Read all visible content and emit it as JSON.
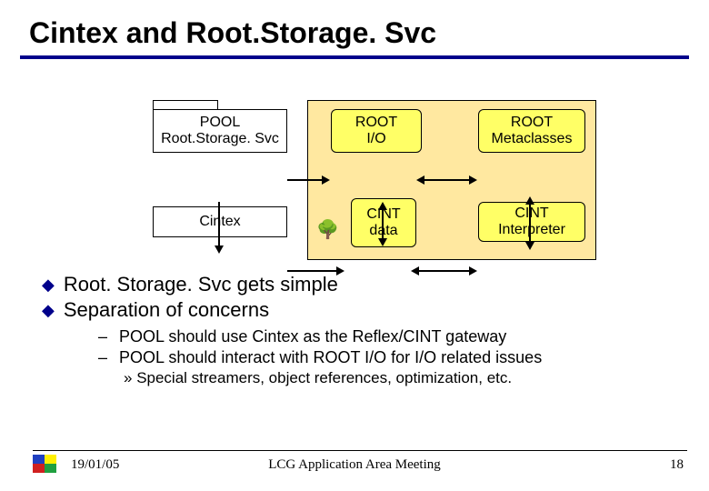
{
  "title": "Cintex and Root.Storage. Svc",
  "diagram": {
    "pool_line1": "POOL",
    "pool_line2": "Root.Storage. Svc",
    "cintex": "Cintex",
    "rootio_line1": "ROOT",
    "rootio_line2": "I/O",
    "rootmeta_line1": "ROOT",
    "rootmeta_line2": "Metaclasses",
    "cint_line1": "CINT",
    "cint_line2": "data",
    "cintinterp_line1": "CINT",
    "cintinterp_line2": "Interpreter"
  },
  "bullets": {
    "b1": "Root. Storage. Svc gets simple",
    "b2": "Separation of concerns",
    "s1": "POOL should use Cintex as the Reflex/CINT gateway",
    "s2": "POOL should interact with ROOT I/O for I/O related issues",
    "ss1": "Special streamers, object references, optimization, etc."
  },
  "footer": {
    "date": "19/01/05",
    "center": "LCG Application Area Meeting",
    "page": "18"
  }
}
